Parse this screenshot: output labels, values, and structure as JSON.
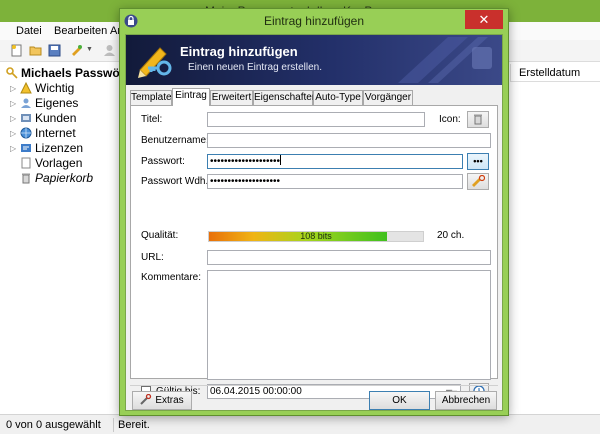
{
  "main_window": {
    "title": "MeinePasswoerter.kdbx - KeePass",
    "menu": [
      "Datei",
      "Bearbeiten",
      "Ansicht"
    ],
    "tree": {
      "root": "Michaels Passwö",
      "items": [
        "Wichtig",
        "Eigenes",
        "Kunden",
        "Internet",
        "Lizenzen",
        "Vorlagen",
        "Papierkorb"
      ]
    },
    "column_header": "Erstelldatum",
    "status": {
      "selection": "0 von 0 ausgewählt",
      "state": "Bereit."
    }
  },
  "dialog": {
    "title": "Eintrag hinzufügen",
    "close_glyph": "✕",
    "banner": {
      "title": "Eintrag hinzufügen",
      "subtitle": "Einen neuen Eintrag erstellen."
    },
    "tabs": [
      "Template",
      "Eintrag",
      "Erweitert",
      "Eigenschaften",
      "Auto-Type",
      "Vorgänger"
    ],
    "active_tab": "Eintrag",
    "form": {
      "title_label": "Titel:",
      "title_value": "",
      "icon_label": "Icon:",
      "username_label": "Benutzername:",
      "username_value": "",
      "password_label": "Passwort:",
      "password_value": "••••••••••••••••••••",
      "show_password_glyph": "•••",
      "repeat_label": "Passwort Wdh.:",
      "repeat_value": "••••••••••••••••••••",
      "quality_label": "Qualität:",
      "quality_text": "108 bits",
      "quality_fraction": 0.83,
      "char_count": "20 ch.",
      "url_label": "URL:",
      "url_value": "",
      "notes_label": "Kommentare:",
      "notes_value": "",
      "expires_label": "Gültig bis:",
      "expires_checked": false,
      "expires_value": "06.04.2015 00:00:00"
    },
    "buttons": {
      "tools": "Extras",
      "ok": "OK",
      "cancel": "Abbrechen"
    }
  },
  "colors": {
    "title_bar": "#98cf56",
    "banner_dark": "#121a3a",
    "close_button": "#c9302c",
    "focus_border": "#3c7fb1"
  }
}
